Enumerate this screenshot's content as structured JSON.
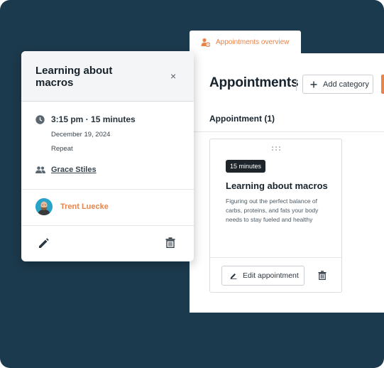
{
  "tab": {
    "label": "Appointments overview",
    "icon": "user-clock-icon"
  },
  "header": {
    "title": "Appointments",
    "add_category_label": "Add category"
  },
  "group": {
    "label": "Appointment (1)"
  },
  "card": {
    "duration": "15 minutes",
    "title": "Learning about macros",
    "description": "Figuring out the perfect balance of carbs, proteins, and fats your body needs to stay fueled and healthy",
    "edit_label": "Edit appointment"
  },
  "popover": {
    "title": "Learning about macros",
    "close": "×",
    "time": "3:15 pm · 15 minutes",
    "date": "December 19, 2024",
    "repeat": "Repeat",
    "attendee": "Grace Stiles",
    "owner": "Trent Luecke"
  },
  "colors": {
    "accent": "#e8844a",
    "background": "#1c3a4d",
    "badge": "#1d252b",
    "avatar_bg": "#2aa3c9"
  }
}
